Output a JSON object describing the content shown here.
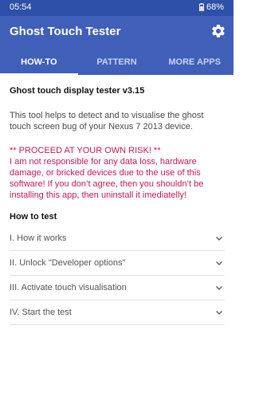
{
  "status_bar": {
    "time": "05:54",
    "battery": "68%"
  },
  "app_bar": {
    "title": "Ghost Touch Tester",
    "settings_icon": "gear-icon"
  },
  "tabs": [
    {
      "label": "HOW-TO",
      "active": true
    },
    {
      "label": "PATTERN",
      "active": false
    },
    {
      "label": "MORE APPS",
      "active": false
    }
  ],
  "main": {
    "version_title": "Ghost touch display tester v3.15",
    "description": "This tool helps to detect and to visualise the ghost touch screen bug of your Nexus 7 2013 device.",
    "warning_heading": "** PROCEED AT YOUR OWN RISK! **",
    "warning_body": "I am not responsible for any data loss, hardware damage, or bricked devices due to the use of this software! If you don’t agree, then you shouldn’t be installing this app, then uninstall it imediatelly!",
    "how_to_heading": "How to test",
    "steps": [
      "I. How it works",
      "II. Unlock \"Developer options\"",
      "III. Activate touch visualisation",
      "IV. Start the test"
    ]
  },
  "colors": {
    "status_bar": "#2f50a8",
    "app_bar": "#3f5fb8",
    "warning_text": "#c2185b"
  }
}
